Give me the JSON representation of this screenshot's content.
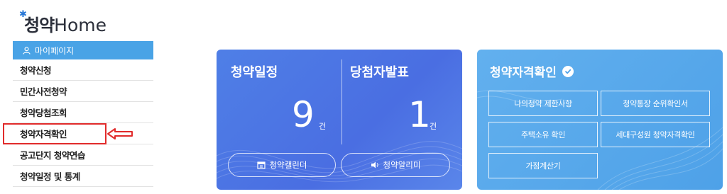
{
  "logo": {
    "ko": "청약",
    "en": "Home"
  },
  "sidebar": {
    "mypage_label": "마이페이지",
    "items": [
      {
        "label": "청약신청"
      },
      {
        "label": "민간사전청약"
      },
      {
        "label": "청약당첨조회"
      },
      {
        "label": "청약자격확인"
      },
      {
        "label": "공고단지 청약연습"
      },
      {
        "label": "청약일정 및 통계"
      }
    ]
  },
  "schedule_card": {
    "left_title": "청약일정",
    "left_count": "9",
    "left_unit": "건",
    "right_title": "당첨자발표",
    "right_count": "1",
    "right_unit": "건",
    "calendar_button": "청약캘린더",
    "alarm_button": "청약알리미"
  },
  "eligibility_card": {
    "title": "청약자격확인",
    "buttons": [
      "나의청약 제한사항",
      "청약통장 순위확인서",
      "주택소유 확인",
      "세대구성원 청약자격확인",
      "가점계산기"
    ]
  },
  "colors": {
    "sidebar_accent": "#49a3e6",
    "schedule_card": "#4a6ee2",
    "eligibility_card": "#4ea1e8",
    "highlight": "#e12b2b"
  }
}
